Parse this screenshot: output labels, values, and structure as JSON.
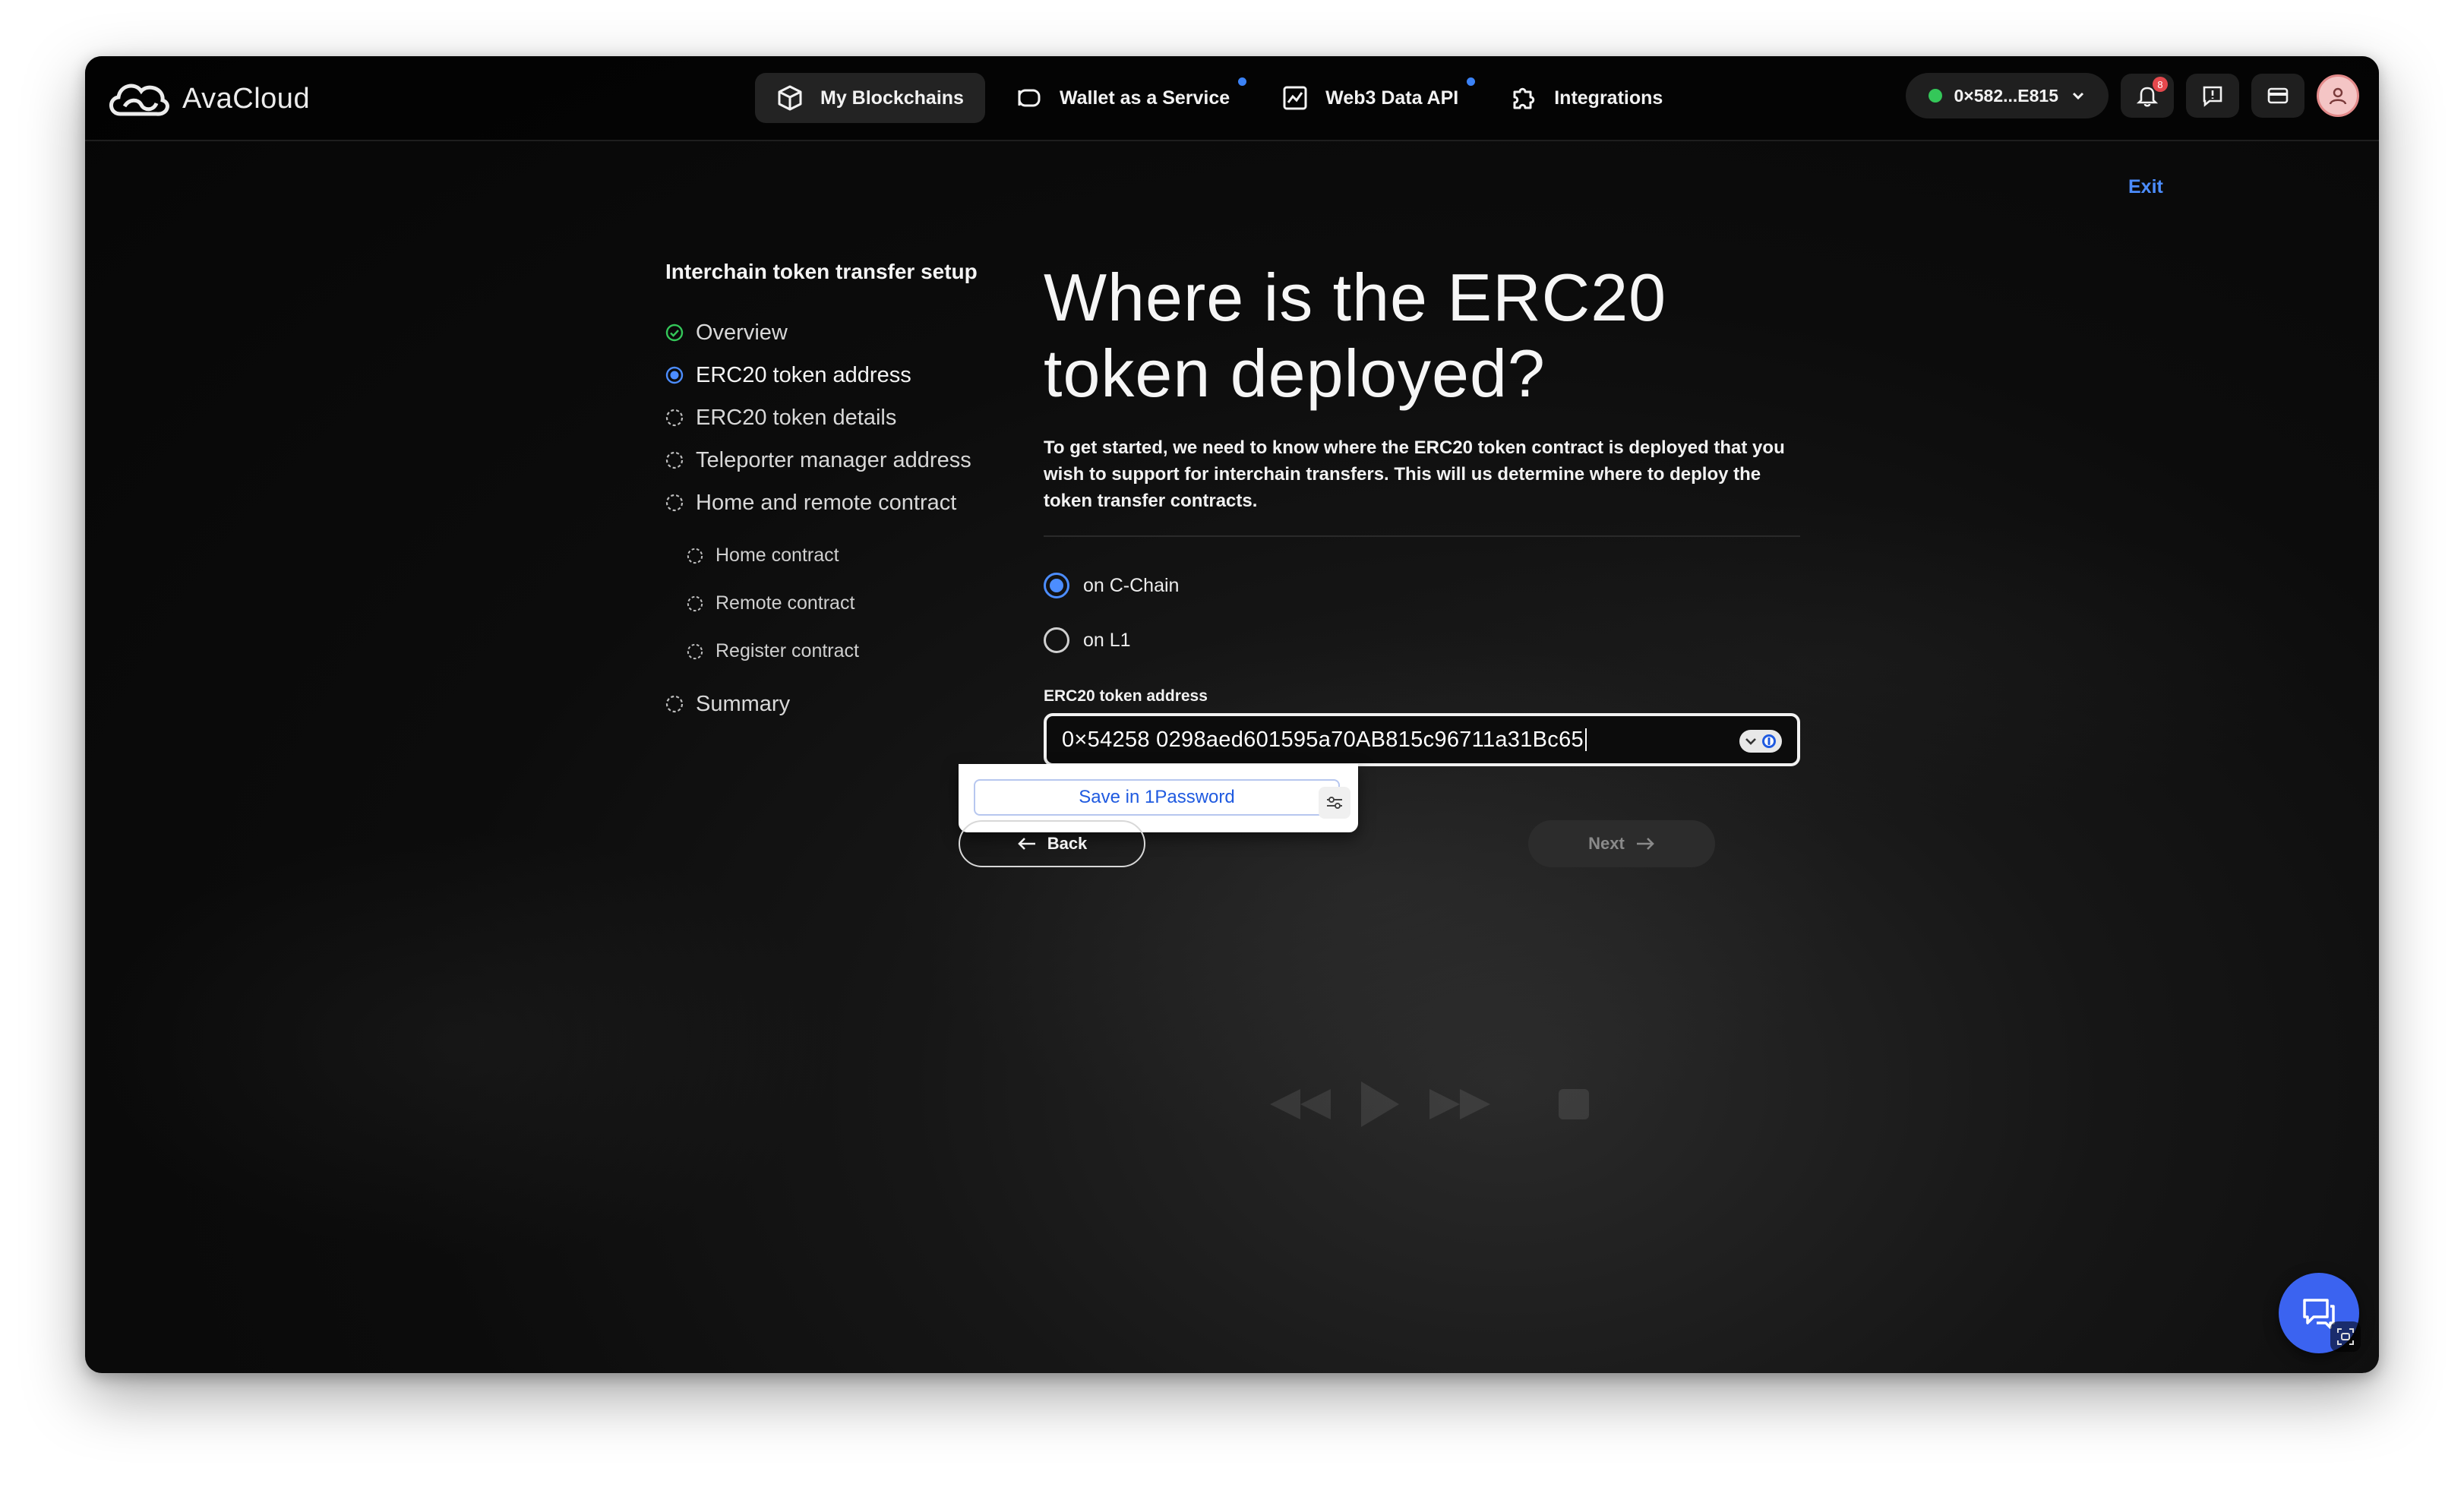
{
  "app": {
    "name": "AvaCloud"
  },
  "nav": {
    "items": [
      {
        "label": "My Blockchains",
        "icon": "cube-icon",
        "active": true,
        "dot": false
      },
      {
        "label": "Wallet as a Service",
        "icon": "wallet-icon",
        "active": false,
        "dot": true
      },
      {
        "label": "Web3 Data API",
        "icon": "chart-icon",
        "active": false,
        "dot": true
      },
      {
        "label": "Integrations",
        "icon": "puzzle-icon",
        "active": false,
        "dot": false
      }
    ],
    "wallet_address": "0×582...E815",
    "notification_count": "8"
  },
  "exit_label": "Exit",
  "sidebar": {
    "title": "Interchain token transfer setup",
    "steps": [
      {
        "label": "Overview",
        "status": "done"
      },
      {
        "label": "ERC20 token address",
        "status": "active"
      },
      {
        "label": "ERC20 token details",
        "status": "pending"
      },
      {
        "label": "Teleporter manager address",
        "status": "pending"
      },
      {
        "label": "Home and remote contract",
        "status": "pending"
      }
    ],
    "substeps": [
      {
        "label": "Home contract"
      },
      {
        "label": "Remote contract"
      },
      {
        "label": "Register contract"
      }
    ],
    "final_step": {
      "label": "Summary",
      "status": "pending"
    }
  },
  "main": {
    "heading_line1": "Where is the ERC20",
    "heading_line2": "token deployed?",
    "description": "To get started, we need to know where the ERC20 token contract is deployed that you wish to support for interchain transfers. This will us determine where to deploy the token transfer contracts.",
    "options": [
      {
        "label": "on C-Chain",
        "selected": true
      },
      {
        "label": "on L1",
        "selected": false
      }
    ],
    "address_label": "ERC20 token address",
    "address_value": "0×54258 0298aed601595a70AB815c96711a31Bc65",
    "password_manager": {
      "save_label": "Save in 1Password"
    },
    "back_label": "Back",
    "next_label": "Next"
  },
  "colors": {
    "accent": "#4c8dff",
    "fab": "#3b63f0",
    "success": "#34c759",
    "badge": "#e5484d"
  }
}
